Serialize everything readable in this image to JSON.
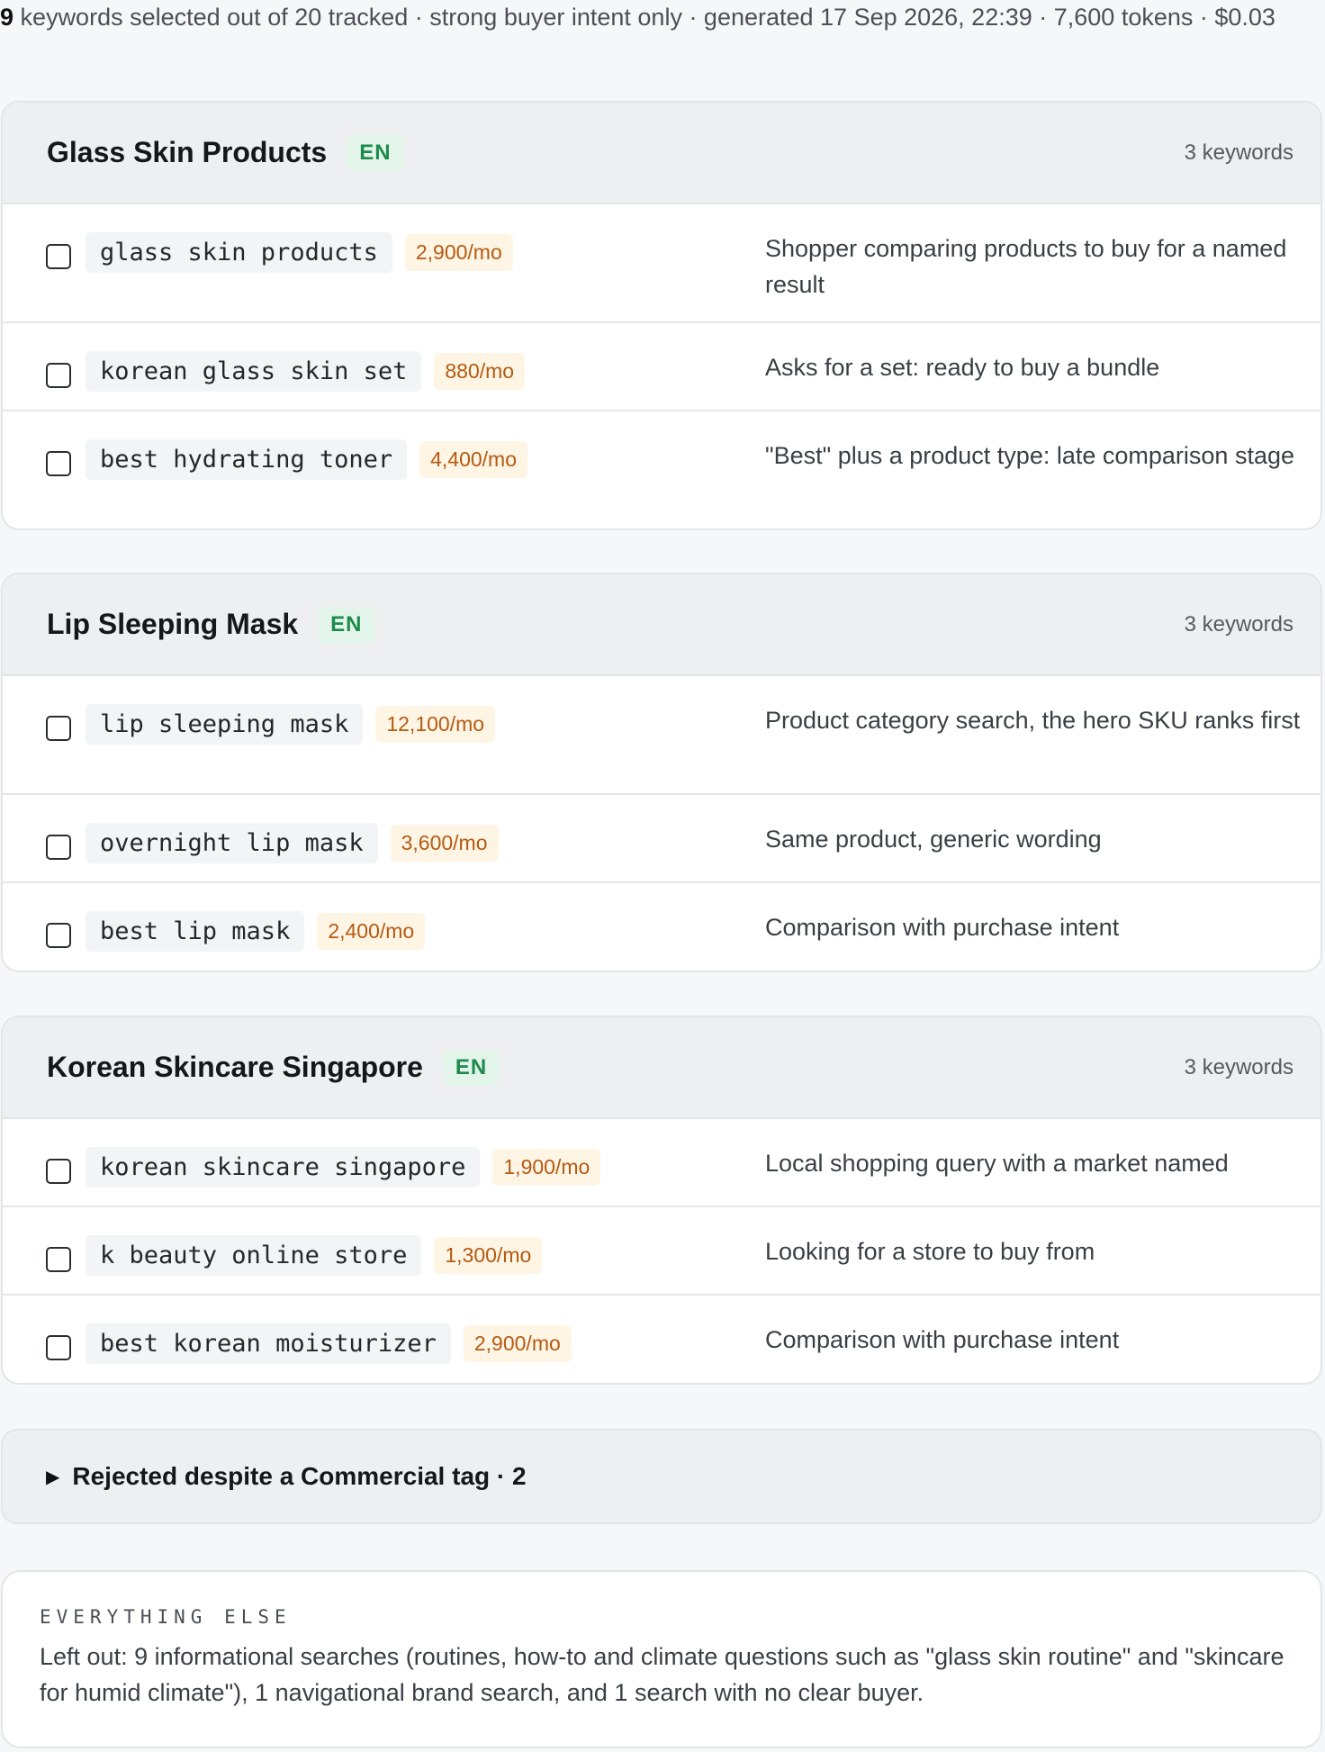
{
  "summary": {
    "selected_count": "9",
    "text": "keywords selected out of 20 tracked · strong buyer intent only · generated 17 Sep 2026, 22:39 · 7,600 tokens · $0.03"
  },
  "groups": [
    {
      "title": "Glass Skin Products",
      "lang": "EN",
      "count_label": "3 keywords",
      "keywords": [
        {
          "keyword": "glass skin products",
          "volume": "2,900/mo",
          "reason": "Shopper comparing products to buy for a named result"
        },
        {
          "keyword": "korean glass skin set",
          "volume": "880/mo",
          "reason": "Asks for a set: ready to buy a bundle"
        },
        {
          "keyword": "best hydrating toner",
          "volume": "4,400/mo",
          "reason": "\"Best\" plus a product type: late comparison stage"
        }
      ]
    },
    {
      "title": "Lip Sleeping Mask",
      "lang": "EN",
      "count_label": "3 keywords",
      "keywords": [
        {
          "keyword": "lip sleeping mask",
          "volume": "12,100/mo",
          "reason": "Product category search, the hero SKU ranks first"
        },
        {
          "keyword": "overnight lip mask",
          "volume": "3,600/mo",
          "reason": "Same product, generic wording"
        },
        {
          "keyword": "best lip mask",
          "volume": "2,400/mo",
          "reason": "Comparison with purchase intent"
        }
      ]
    },
    {
      "title": "Korean Skincare Singapore",
      "lang": "EN",
      "count_label": "3 keywords",
      "keywords": [
        {
          "keyword": "korean skincare singapore",
          "volume": "1,900/mo",
          "reason": "Local shopping query with a market named"
        },
        {
          "keyword": "k beauty online store",
          "volume": "1,300/mo",
          "reason": "Looking for a store to buy from"
        },
        {
          "keyword": "best korean moisturizer",
          "volume": "2,900/mo",
          "reason": "Comparison with purchase intent"
        }
      ]
    }
  ],
  "rejected": {
    "label": "Rejected despite a Commercial tag · 2",
    "icon": "triangle-right-icon"
  },
  "everything_else": {
    "heading": "EVERYTHING ELSE",
    "text": "Left out: 9 informational searches (routines, how-to and climate questions such as \"glass skin routine\" and \"skincare for humid climate\"), 1 navigational brand search, and 1 search with no clear buyer."
  },
  "colors": {
    "badge_bg": "#e3f5ea",
    "badge_text": "#1e8a4c",
    "volume_bg": "#fff5e4",
    "volume_text": "#b55a12"
  }
}
